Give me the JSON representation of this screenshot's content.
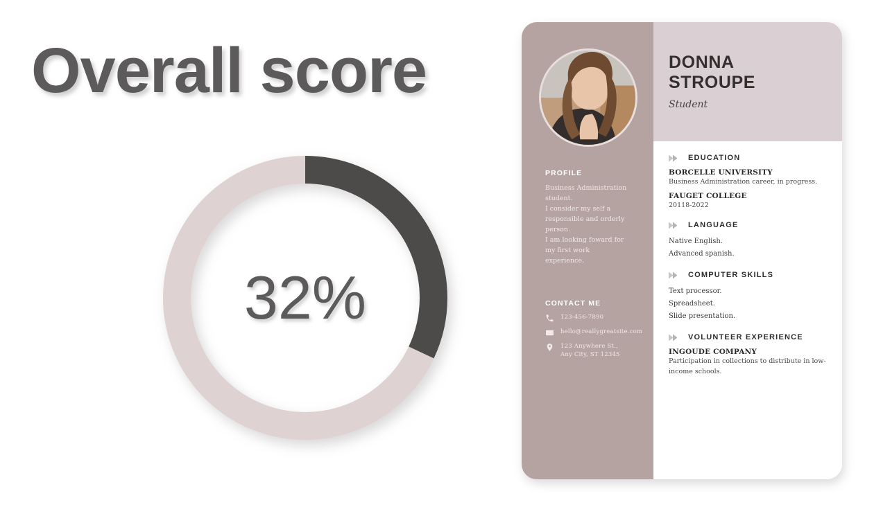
{
  "score": {
    "title": "Overall score",
    "percent_label": "32%",
    "percent_value": 32,
    "track_color": "#ded2d2",
    "fill_color": "#4d4a4a",
    "title_color": "#5c5a5a"
  },
  "chart_data": {
    "type": "pie",
    "title": "Overall score",
    "variant": "donut",
    "categories": [
      "Score",
      "Remaining"
    ],
    "values": [
      32,
      68
    ],
    "colors": [
      "#4d4a4a",
      "#ded2d2"
    ],
    "center_label": "32%",
    "start_angle_deg": 0,
    "direction": "clockwise",
    "legend": "none",
    "grid": false
  },
  "resume": {
    "colors": {
      "sidebar": "#b5a3a1",
      "name_band": "#dacfd3",
      "card_background": "#ffffff"
    },
    "avatar_name": "portrait-photo",
    "header": {
      "name_first": "DONNA",
      "name_last": "STROUPE",
      "job_title": "Student"
    },
    "profile": {
      "heading": "PROFILE",
      "lines": [
        "Business Administration",
        "student.",
        "I consider my self a",
        "responsible and orderly",
        "person.",
        "I am looking foward for",
        "my first work",
        "experience."
      ]
    },
    "contact": {
      "heading": "CONTACT ME",
      "items": [
        {
          "icon": "phone-icon",
          "lines": [
            "123-456-7890"
          ]
        },
        {
          "icon": "envelope-icon",
          "lines": [
            "hello@reallygreatsite.com"
          ]
        },
        {
          "icon": "location-pin-icon",
          "lines": [
            "123 Anywhere St.,",
            "Any City, ST 12345"
          ]
        }
      ]
    },
    "sections": [
      {
        "title": "EDUCATION",
        "entries": [
          {
            "org": "BORCELLE UNIVERSITY",
            "desc": "Business Administration career, in progress."
          },
          {
            "org": "FAUGET COLLEGE",
            "desc": "20118-2022"
          }
        ],
        "lines": []
      },
      {
        "title": "LANGUAGE",
        "entries": [],
        "lines": [
          "Native English.",
          "Advanced spanish."
        ]
      },
      {
        "title": "COMPUTER SKILLS",
        "entries": [],
        "lines": [
          "Text processor.",
          "Spreadsheet.",
          "Slide presentation."
        ]
      },
      {
        "title": "VOLUNTEER EXPERIENCE",
        "entries": [
          {
            "org": "INGOUDE COMPANY",
            "desc": "Participation in collections to distribute in low-income schools."
          }
        ],
        "lines": []
      }
    ]
  }
}
